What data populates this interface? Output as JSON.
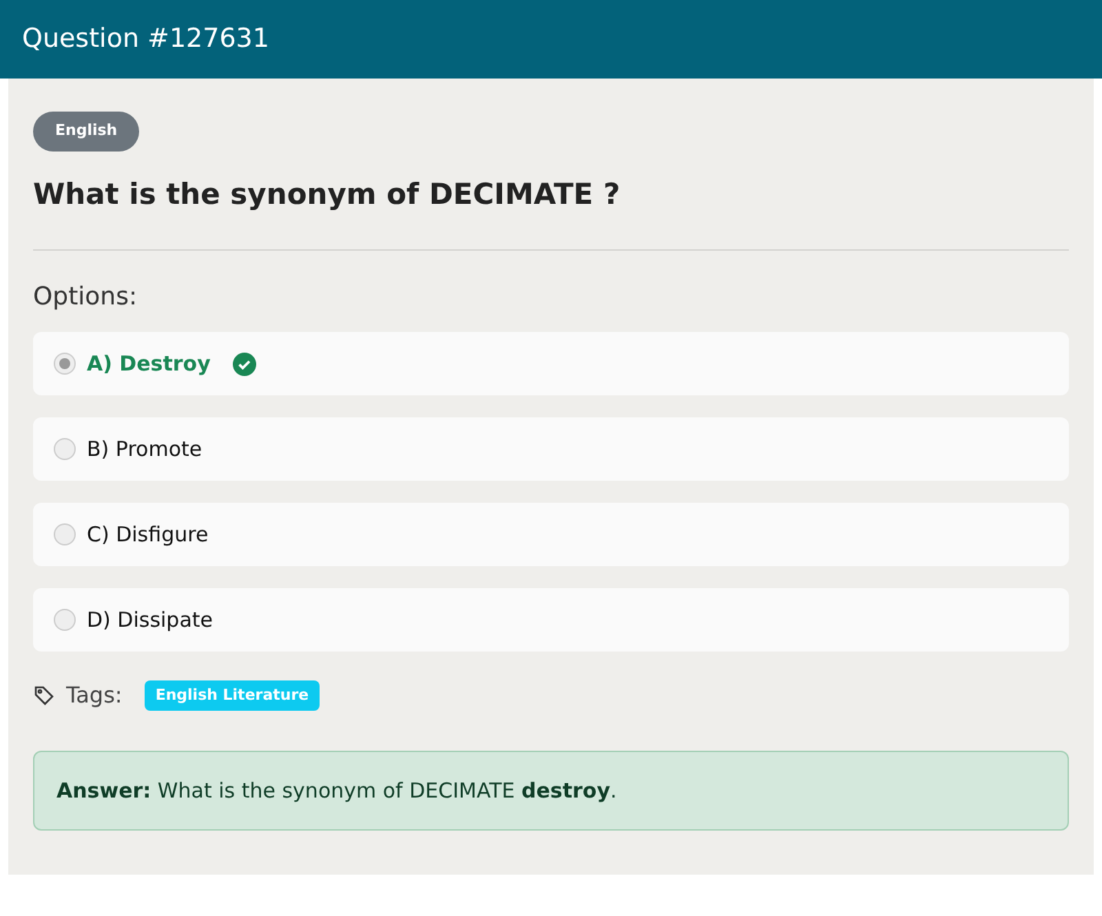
{
  "header": {
    "title": "Question #127631"
  },
  "category": "English",
  "question": "What is the synonym of DECIMATE ?",
  "options_label": "Options:",
  "options": [
    {
      "label": "A) Destroy",
      "selected": true,
      "correct": true
    },
    {
      "label": "B) Promote",
      "selected": false,
      "correct": false
    },
    {
      "label": "C) Disfigure",
      "selected": false,
      "correct": false
    },
    {
      "label": "D) Dissipate",
      "selected": false,
      "correct": false
    }
  ],
  "tags_label": "Tags:",
  "tags": [
    "English Literature"
  ],
  "answer": "**Answer:** What is the synonym of DECIMATE **destroy**."
}
